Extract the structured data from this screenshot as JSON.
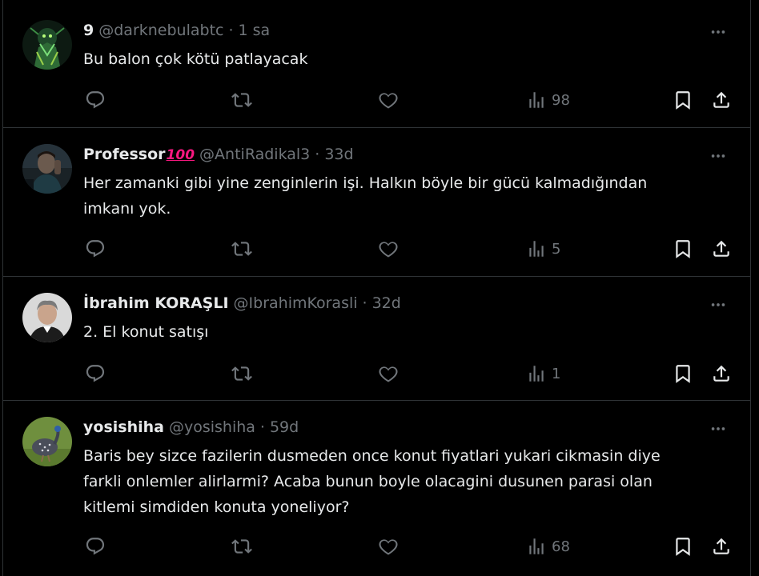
{
  "tweets": [
    {
      "name": "9",
      "emoji": "",
      "handle": "@darknebulabtc",
      "separator": "·",
      "time": "1 sa",
      "text": "Bu balon çok kötü patlayacak",
      "views": "98",
      "avatar": "green-figure"
    },
    {
      "name": "Professor",
      "emoji": "100",
      "handle": "@AntiRadikal3",
      "separator": "·",
      "time": "33d",
      "text": "Her zamanki gibi yine zenginlerin işi. Halkın böyle bir gücü kalmadığından\nimkanı yok.",
      "views": "5",
      "avatar": "man-dark"
    },
    {
      "name": "İbrahim KORAŞLI",
      "emoji": "",
      "handle": "@IbrahimKorasli",
      "separator": "·",
      "time": "32d",
      "text": "2. El konut satışı",
      "views": "1",
      "avatar": "man-grey"
    },
    {
      "name": "yosishiha",
      "emoji": "",
      "handle": "@yosishiha",
      "separator": "·",
      "time": "59d",
      "text": "Baris bey sizce fazilerin dusmeden once konut fiyatlari yukari cikmasin diye\nfarkli onlemler alirlarmi? Acaba bunun boyle olacagini dusunen parasi olan\nkitlemi simdiden konuta yoneliyor?",
      "views": "68",
      "avatar": "guineafowl"
    }
  ],
  "colors": {
    "background": "#000000",
    "text": "#e7e9ea",
    "muted": "#71767b",
    "border": "#2f3336",
    "emoji": "#f91880"
  },
  "icons": [
    "reply-icon",
    "retweet-icon",
    "like-icon",
    "views-icon",
    "bookmark-icon",
    "share-icon",
    "more-icon"
  ]
}
